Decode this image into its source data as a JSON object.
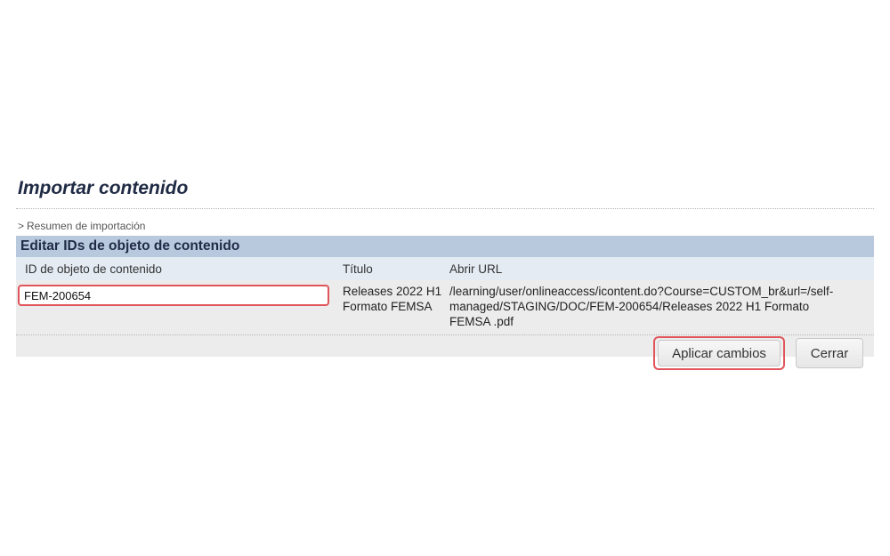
{
  "page": {
    "title": "Importar contenido",
    "breadcrumb": {
      "arrow": ">",
      "label": "Resumen de importación"
    }
  },
  "panel": {
    "header": "Editar IDs de objeto de contenido",
    "columns": [
      "ID de objeto de contenido",
      "Título",
      "Abrir URL"
    ],
    "row": {
      "id_value": "FEM-200654",
      "titulo": "Releases 2022 H1 Formato FEMSA",
      "url": "/learning/user/onlineaccess/icontent.do?Course=CUSTOM_br&url=/self-managed/STAGING/DOC/FEM-200654/Releases 2022 H1 Formato FEMSA .pdf"
    }
  },
  "actions": {
    "apply_label": "Aplicar cambios",
    "close_label": "Cerrar"
  },
  "colors": {
    "panel_header_bg": "#b8c9de",
    "column_header_bg": "#e4ebf3",
    "row_bg": "#ececec",
    "highlight": "#e0545a",
    "title_color": "#1f2a44"
  }
}
